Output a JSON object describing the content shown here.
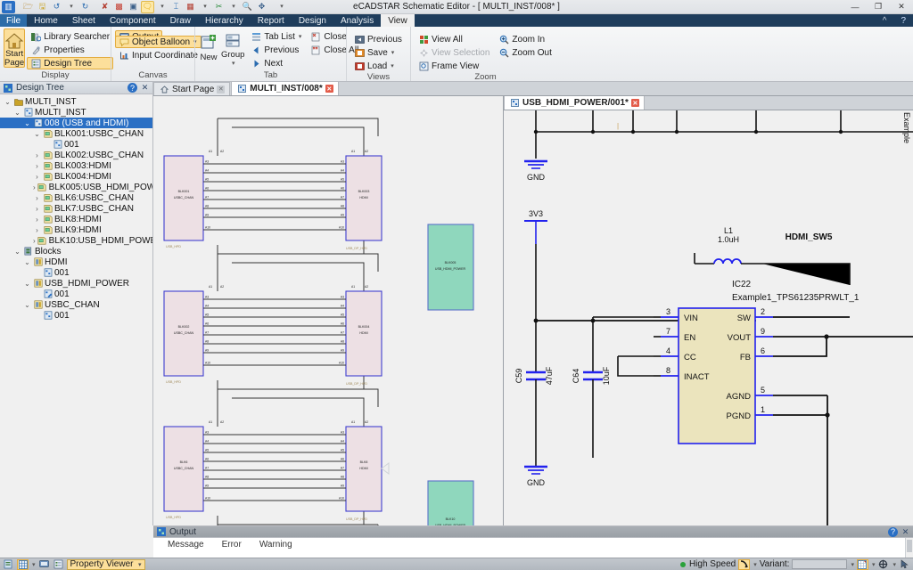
{
  "window": {
    "title": "eCADSTAR Schematic Editor - [ MULTI_INST/008* ]",
    "minimize": "—",
    "restore": "❐",
    "close": "✕",
    "help": "?",
    "collapse_ribbon": "^"
  },
  "quick_access": [
    {
      "name": "app-icon",
      "glyph": "▥"
    },
    {
      "name": "open-icon",
      "glyph": "📂"
    },
    {
      "name": "save-icon",
      "glyph": "💾"
    },
    {
      "name": "undo-icon",
      "glyph": "↺"
    },
    {
      "name": "redo-icon",
      "glyph": "↻"
    },
    {
      "name": "delete-icon",
      "glyph": "✘"
    },
    {
      "name": "grid-icon",
      "glyph": "▩"
    },
    {
      "name": "zoom-window-icon",
      "glyph": "🔍"
    },
    {
      "name": "balloon-icon",
      "glyph": "💬"
    },
    {
      "name": "chart-icon",
      "glyph": "⌶"
    },
    {
      "name": "board-icon",
      "glyph": "▦"
    },
    {
      "name": "tools-icon",
      "glyph": "✂"
    },
    {
      "name": "find-icon",
      "glyph": "🔍"
    },
    {
      "name": "move-icon",
      "glyph": "✥"
    },
    {
      "name": "qat-overflow-icon",
      "glyph": "▾"
    }
  ],
  "menu": {
    "file": "File",
    "items": [
      "Home",
      "Sheet",
      "Component",
      "Draw",
      "Hierarchy",
      "Report",
      "Design",
      "Analysis",
      "View"
    ],
    "active": "View"
  },
  "ribbon": {
    "groups": [
      {
        "label": "Display",
        "big": {
          "label": "Start Page",
          "icon": "home-icon",
          "selected": true
        },
        "buttons": [
          {
            "label": "Library Searcher",
            "icon": "library-icon",
            "selected": false,
            "dropdown": false
          },
          {
            "label": "Properties",
            "icon": "properties-icon",
            "selected": false,
            "dropdown": false
          },
          {
            "label": "Design Tree",
            "icon": "tree-icon",
            "selected": true,
            "dropdown": false
          },
          {
            "label": "Output",
            "icon": "output-icon",
            "selected": true,
            "dropdown": false
          }
        ]
      },
      {
        "label": "Canvas",
        "buttons": [
          {
            "label": "Object Balloon",
            "icon": "balloon-icon",
            "selected": true,
            "dropdown": true
          },
          {
            "label": "Input Coordinate",
            "icon": "coordinate-icon",
            "selected": false,
            "dropdown": false
          }
        ]
      },
      {
        "label": "Tab",
        "big2": [
          {
            "label": "New",
            "icon": "new-tab-icon"
          },
          {
            "label": "Group",
            "icon": "group-tab-icon",
            "dropdown": true
          }
        ],
        "buttons": [
          {
            "label": "Tab List",
            "icon": "tab-list-icon",
            "selected": false,
            "dropdown": true
          },
          {
            "label": "Previous",
            "icon": "previous-icon",
            "selected": false,
            "dropdown": false
          },
          {
            "label": "Next",
            "icon": "next-icon",
            "selected": false,
            "dropdown": false
          },
          {
            "label": "Close",
            "icon": "close-tab-icon",
            "selected": false,
            "dropdown": false
          },
          {
            "label": "Close All",
            "icon": "close-all-icon",
            "selected": false,
            "dropdown": false
          }
        ]
      },
      {
        "label": "Views",
        "buttons": [
          {
            "label": "Previous",
            "icon": "view-previous-icon",
            "selected": false,
            "dropdown": false
          },
          {
            "label": "Save",
            "icon": "view-save-icon",
            "selected": false,
            "dropdown": true
          },
          {
            "label": "Load",
            "icon": "view-load-icon",
            "selected": false,
            "dropdown": true
          }
        ]
      },
      {
        "label": "Zoom",
        "buttons": [
          {
            "label": "View All",
            "icon": "view-all-icon",
            "selected": false,
            "disabled": false
          },
          {
            "label": "View Selection",
            "icon": "view-selection-icon",
            "selected": false,
            "disabled": true
          },
          {
            "label": "Frame View",
            "icon": "frame-view-icon",
            "selected": false,
            "disabled": false
          },
          {
            "label": "Zoom In",
            "icon": "zoom-in-icon",
            "selected": false,
            "disabled": false
          },
          {
            "label": "Zoom Out",
            "icon": "zoom-out-icon",
            "selected": false,
            "disabled": false
          }
        ]
      }
    ]
  },
  "design_tree": {
    "title": "Design Tree",
    "help": "?",
    "close": "✕",
    "nodes": [
      {
        "depth": 0,
        "label": "MULTI_INST",
        "icon": "project-icon",
        "twisty": "open",
        "selected": false
      },
      {
        "depth": 1,
        "label": "MULTI_INST",
        "icon": "sheet-icon",
        "twisty": "open",
        "selected": false
      },
      {
        "depth": 2,
        "label": "008 (USB and HDMI)",
        "icon": "sheet-icon",
        "twisty": "open",
        "selected": true
      },
      {
        "depth": 3,
        "label": "BLK001:USBC_CHAN",
        "icon": "block-icon",
        "twisty": "open",
        "selected": false
      },
      {
        "depth": 4,
        "label": "001",
        "icon": "sheet-icon",
        "twisty": "none",
        "selected": false
      },
      {
        "depth": 3,
        "label": "BLK002:USBC_CHAN",
        "icon": "block-icon",
        "twisty": "closed",
        "selected": false
      },
      {
        "depth": 3,
        "label": "BLK003:HDMI",
        "icon": "block-icon",
        "twisty": "closed",
        "selected": false
      },
      {
        "depth": 3,
        "label": "BLK004:HDMI",
        "icon": "block-icon",
        "twisty": "closed",
        "selected": false
      },
      {
        "depth": 3,
        "label": "BLK005:USB_HDMI_POWER",
        "icon": "block-icon",
        "twisty": "closed",
        "selected": false
      },
      {
        "depth": 3,
        "label": "BLK6:USBC_CHAN",
        "icon": "block-icon",
        "twisty": "closed",
        "selected": false
      },
      {
        "depth": 3,
        "label": "BLK7:USBC_CHAN",
        "icon": "block-icon",
        "twisty": "closed",
        "selected": false
      },
      {
        "depth": 3,
        "label": "BLK8:HDMI",
        "icon": "block-icon",
        "twisty": "closed",
        "selected": false
      },
      {
        "depth": 3,
        "label": "BLK9:HDMI",
        "icon": "block-icon",
        "twisty": "closed",
        "selected": false
      },
      {
        "depth": 3,
        "label": "BLK10:USB_HDMI_POWER",
        "icon": "block-icon",
        "twisty": "closed",
        "selected": false
      },
      {
        "depth": 1,
        "label": "Blocks",
        "icon": "blocks-icon",
        "twisty": "open",
        "selected": false
      },
      {
        "depth": 2,
        "label": "HDMI",
        "icon": "blockdef-icon",
        "twisty": "open",
        "selected": false
      },
      {
        "depth": 3,
        "label": "001",
        "icon": "sheet-icon",
        "twisty": "none",
        "selected": false
      },
      {
        "depth": 2,
        "label": "USB_HDMI_POWER",
        "icon": "blockdef-icon",
        "twisty": "open",
        "selected": false
      },
      {
        "depth": 3,
        "label": "001",
        "icon": "sheet-edit-icon",
        "twisty": "none",
        "selected": false
      },
      {
        "depth": 2,
        "label": "USBC_CHAN",
        "icon": "blockdef-icon",
        "twisty": "open",
        "selected": false
      },
      {
        "depth": 3,
        "label": "001",
        "icon": "sheet-icon",
        "twisty": "none",
        "selected": false
      }
    ]
  },
  "tabs": {
    "left": [
      {
        "label": "Start Page",
        "icon": "home-icon",
        "active": false,
        "closable": true,
        "close_style": "gray"
      },
      {
        "label": "MULTI_INST/008*",
        "icon": "sheet-icon",
        "active": true,
        "closable": true,
        "close_style": "red"
      }
    ],
    "right": [
      {
        "label": "USB_HDMI_POWER/001*",
        "icon": "sheet-icon",
        "active": true,
        "closable": true,
        "close_style": "red"
      }
    ]
  },
  "schematic_left": {
    "blocks": [
      {
        "id": "grp1",
        "left_block": {
          "ref": "BLK001",
          "name": "USBC_CHAN"
        },
        "right_block": {
          "ref": "BLK003",
          "name": "HDMI"
        },
        "top_pins": [
          "A1",
          "A2"
        ],
        "pins": [
          "A3",
          "A4",
          "A5",
          "A6",
          "A7",
          "A8",
          "A9",
          "A10"
        ],
        "left_net": "USB_HPD",
        "right_net": "USB_DP_HPD"
      },
      {
        "id": "grp2",
        "left_block": {
          "ref": "BLK002",
          "name": "USBC_CHAN"
        },
        "right_block": {
          "ref": "BLK004",
          "name": "HDMI"
        },
        "top_pins": [
          "A1",
          "A2"
        ],
        "pins": [
          "A3",
          "A4",
          "A5",
          "A6",
          "A7",
          "A8",
          "A9",
          "A10"
        ],
        "left_net": "USB_HPD",
        "right_net": "USB_DP_HPD"
      },
      {
        "id": "grp3",
        "left_block": {
          "ref": "BLK6",
          "name": "USBC_CHAN"
        },
        "right_block": {
          "ref": "BLK8",
          "name": "HDMI"
        },
        "top_pins": [
          "A1",
          "A2"
        ],
        "pins": [
          "A3",
          "A4",
          "A5",
          "A6",
          "A7",
          "A8",
          "A9",
          "A10"
        ],
        "left_net": "USB_HPD",
        "right_net": "USB_DP_HPD"
      }
    ],
    "power_blocks": [
      {
        "ref": "BLK005",
        "name": "USB_HDMI_POWER"
      },
      {
        "ref": "BLK10",
        "name": "USB_HDMI_POWER"
      }
    ]
  },
  "schematic_right": {
    "net_3v3": "3V3",
    "gnd_top": "GND",
    "gnd_bottom": "GND",
    "capacitors": [
      {
        "ref": "C59",
        "value": "47uF"
      },
      {
        "ref": "C64",
        "value": "10uF"
      }
    ],
    "inductor": {
      "ref": "L1",
      "value": "1.0uH"
    },
    "net_sw": "HDMI_SW5",
    "ic": {
      "ref": "IC22",
      "part": "Example1_TPS61235PRWLT_1",
      "left_pins": [
        {
          "num": "3",
          "name": "VIN"
        },
        {
          "num": "7",
          "name": "EN"
        },
        {
          "num": "4",
          "name": "CC"
        },
        {
          "num": "8",
          "name": "INACT"
        }
      ],
      "right_pins": [
        {
          "num": "2",
          "name": "SW"
        },
        {
          "num": "9",
          "name": "VOUT"
        },
        {
          "num": "6",
          "name": "FB"
        },
        {
          "num": "5",
          "name": "AGND"
        },
        {
          "num": "1",
          "name": "PGND"
        }
      ]
    },
    "edge_label": "Example"
  },
  "output": {
    "title": "Output",
    "help": "?",
    "close": "✕",
    "tabs": [
      "Message",
      "Error",
      "Warning"
    ]
  },
  "status": {
    "icons": [
      {
        "name": "property-viewer-icon",
        "glyph": "▤",
        "selected": false
      },
      {
        "name": "grid-toggle-icon",
        "glyph": "▦",
        "selected": true
      },
      {
        "name": "monitor-icon",
        "glyph": "🖵",
        "selected": false
      },
      {
        "name": "tree-toggle-icon",
        "glyph": "▤",
        "selected": false
      }
    ],
    "combo_label": "Property Viewer",
    "high_speed": "High Speed",
    "variant_label": "Variant:",
    "variant_value": "",
    "right_icons": [
      {
        "name": "snap-icon",
        "glyph": "↘"
      },
      {
        "name": "grid-settings-icon",
        "glyph": "▦"
      },
      {
        "name": "crosshair-icon",
        "glyph": "✥"
      },
      {
        "name": "pointer-icon",
        "glyph": "↖"
      }
    ]
  },
  "colors": {
    "accent_blue": "#2a6fc4",
    "ribbon_gold": "#fcdf9b",
    "block_pink": "#ede0e4",
    "block_green": "#8fd7bd",
    "ic_tan": "#ebe4bd",
    "wire_blue": "#2222ee",
    "titlebar_dark": "#1f3d5c"
  }
}
